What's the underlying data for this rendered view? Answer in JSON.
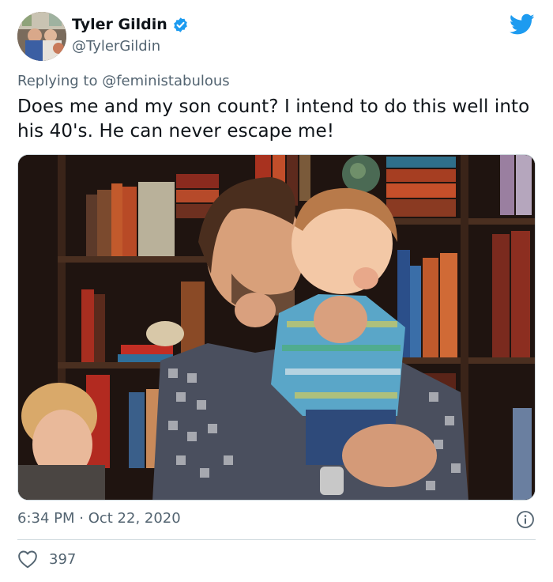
{
  "author": {
    "display_name": "Tyler Gildin",
    "handle": "@TylerGildin",
    "verified": true
  },
  "reply": {
    "prefix": "Replying to ",
    "mention": "@feministabulous"
  },
  "tweet": {
    "text": "Does me and my son count? I intend to do this well into his 40's. He can never escape me!",
    "timestamp": "6:34 PM · Oct 22, 2020",
    "likes": "397"
  },
  "icons": {
    "verified": "verified-badge-icon",
    "bird": "twitter-bird-icon",
    "info": "info-icon",
    "like": "heart-icon"
  },
  "colors": {
    "accent": "#1d9bf0",
    "secondary_text": "#536471",
    "divider": "#cfd9de"
  }
}
